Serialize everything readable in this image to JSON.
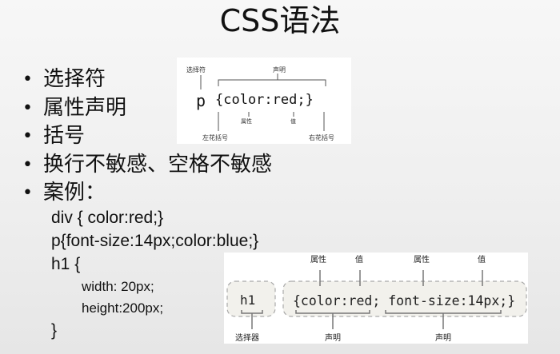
{
  "slide": {
    "title": "CSS语法",
    "bullets": [
      "选择符",
      "属性声明",
      "括号",
      "换行不敏感、空格不敏感",
      "案例："
    ],
    "example": {
      "line1": "div { color:red;}",
      "line2": "p{font-size:14px;color:blue;}",
      "line3": "h1 {",
      "line4": "width: 20px;",
      "line5": "height:200px;",
      "line6": "}"
    }
  },
  "figure1": {
    "selector_label": "选择符",
    "declaration_label": "声明",
    "property_label": "属性",
    "value_label": "值",
    "left_brace_label": "左花括号",
    "right_brace_label": "右花括号",
    "selector": "p",
    "code": "{color:red;}"
  },
  "figure2": {
    "selector": "h1",
    "declarations": "{color:red; font-size:14px;}",
    "property_label_1": "属性",
    "value_label_1": "值",
    "property_label_2": "属性",
    "value_label_2": "值",
    "selector_label": "选择器",
    "declaration_label_1": "声明",
    "declaration_label_2": "声明"
  }
}
